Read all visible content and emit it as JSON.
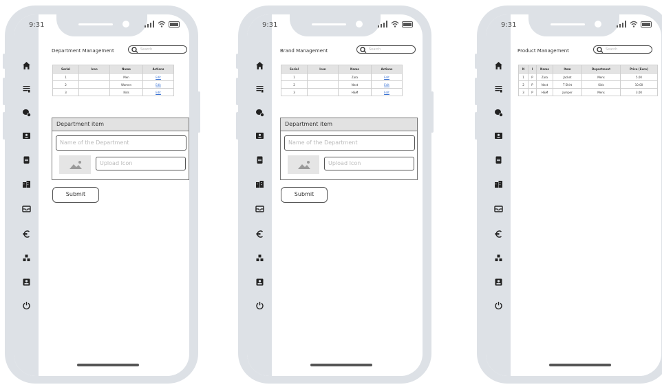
{
  "status_bar": {
    "time": "9:31"
  },
  "nav_icons": [
    "home-icon",
    "list-icon",
    "coins-icon",
    "id-card-icon",
    "clipboard-icon",
    "buildings-icon",
    "inbox-icon",
    "euro-icon",
    "cubes-icon",
    "contact-icon",
    "power-icon"
  ],
  "phones": [
    {
      "title": "Department Management",
      "search_placeholder": "Search",
      "table": {
        "headers": [
          "Serial",
          "Icon",
          "Name",
          "Actions"
        ],
        "rows": [
          [
            "1",
            "",
            "Men",
            "Edit"
          ],
          [
            "2",
            "",
            "Women",
            "Edit"
          ],
          [
            "3",
            "",
            "Kids",
            "Edit"
          ]
        ]
      },
      "form": {
        "heading": "Department item",
        "name_placeholder": "Name of the Department",
        "upload_placeholder": "Upload Icon",
        "submit_label": "Submit"
      }
    },
    {
      "title": "Brand Management",
      "search_placeholder": "Search",
      "table": {
        "headers": [
          "Serial",
          "Icon",
          "Name",
          "Actions"
        ],
        "rows": [
          [
            "1",
            "",
            "Zara",
            "Edit"
          ],
          [
            "2",
            "",
            "Next",
            "Edit"
          ],
          [
            "3",
            "",
            "H&M",
            "Edit"
          ]
        ]
      },
      "form": {
        "heading": "Department item",
        "name_placeholder": "Name of the Department",
        "upload_placeholder": "Upload Icon",
        "submit_label": "Submit"
      }
    },
    {
      "title": "Product Management",
      "search_placeholder": "Search",
      "table": {
        "headers": [
          "N",
          "I",
          "Name",
          "Item",
          "Department",
          "Price (Euro)"
        ],
        "rows": [
          [
            "1",
            "P",
            "Zara",
            "Jacket",
            "Mens",
            "5.00"
          ],
          [
            "2",
            "P",
            "Next",
            "T Shirt",
            "Kids",
            "10.00"
          ],
          [
            "3",
            "P",
            "H&M",
            "Jumper",
            "Mens",
            "3.00"
          ]
        ]
      }
    }
  ]
}
